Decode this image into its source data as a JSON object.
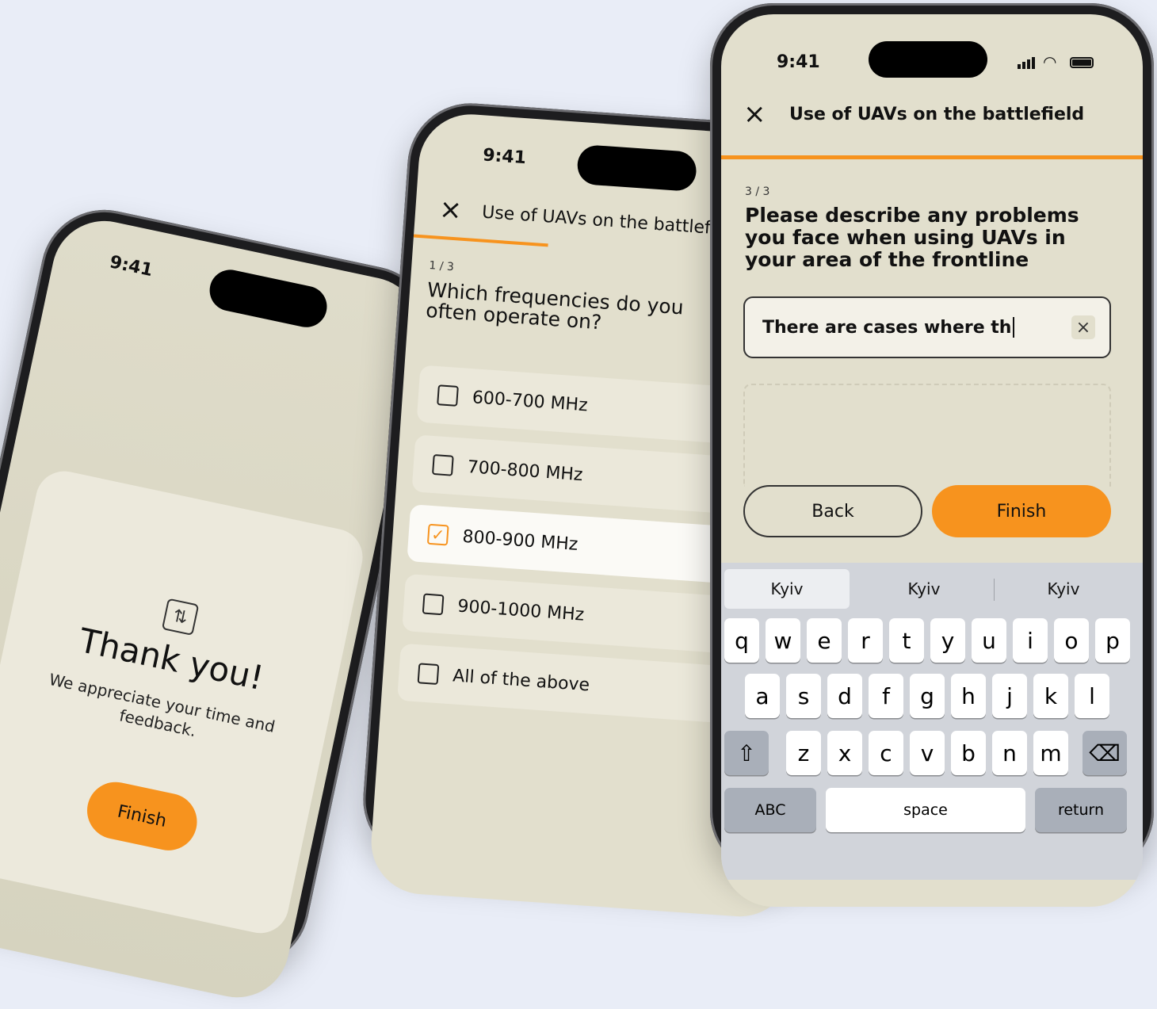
{
  "status": {
    "time": "9:41"
  },
  "phone1": {
    "thanks_title": "Thank you!",
    "thanks_sub": "We appreciate your time and feedback.",
    "finish": "Finish"
  },
  "phone2": {
    "title": "Use of UAVs on the battlefield",
    "step": "1 / 3",
    "question": "Which frequencies do you often operate on?",
    "progress": 0.33,
    "options": [
      {
        "label": "600-700 MHz",
        "checked": false
      },
      {
        "label": "700-800 MHz",
        "checked": false
      },
      {
        "label": "800-900 MHz",
        "checked": true
      },
      {
        "label": "900-1000 MHz",
        "checked": false
      },
      {
        "label": "All of the above",
        "checked": false
      }
    ]
  },
  "phone3": {
    "title": "Use of UAVs on the battlefield",
    "step": "3 / 3",
    "question": "Please describe any problems you face when using UAVs in your area of the frontline",
    "progress": 1.0,
    "input_value": "There are cases where th",
    "back": "Back",
    "finish": "Finish",
    "suggestions": [
      "Kyiv",
      "Kyiv",
      "Kyiv"
    ],
    "keys_row1": [
      "q",
      "w",
      "e",
      "r",
      "t",
      "y",
      "u",
      "i",
      "o",
      "p"
    ],
    "keys_row2": [
      "a",
      "s",
      "d",
      "f",
      "g",
      "h",
      "j",
      "k",
      "l"
    ],
    "keys_row3": [
      "z",
      "x",
      "c",
      "v",
      "b",
      "n",
      "m"
    ],
    "abc": "ABC",
    "space": "space",
    "return": "return"
  },
  "icons": {
    "close": "×",
    "check": "✓",
    "shift": "⇧",
    "backspace": "⌫",
    "clear": "×"
  },
  "colors": {
    "accent": "#f7931e",
    "screen": "#e2dfcd",
    "background": "#e9edf7"
  }
}
